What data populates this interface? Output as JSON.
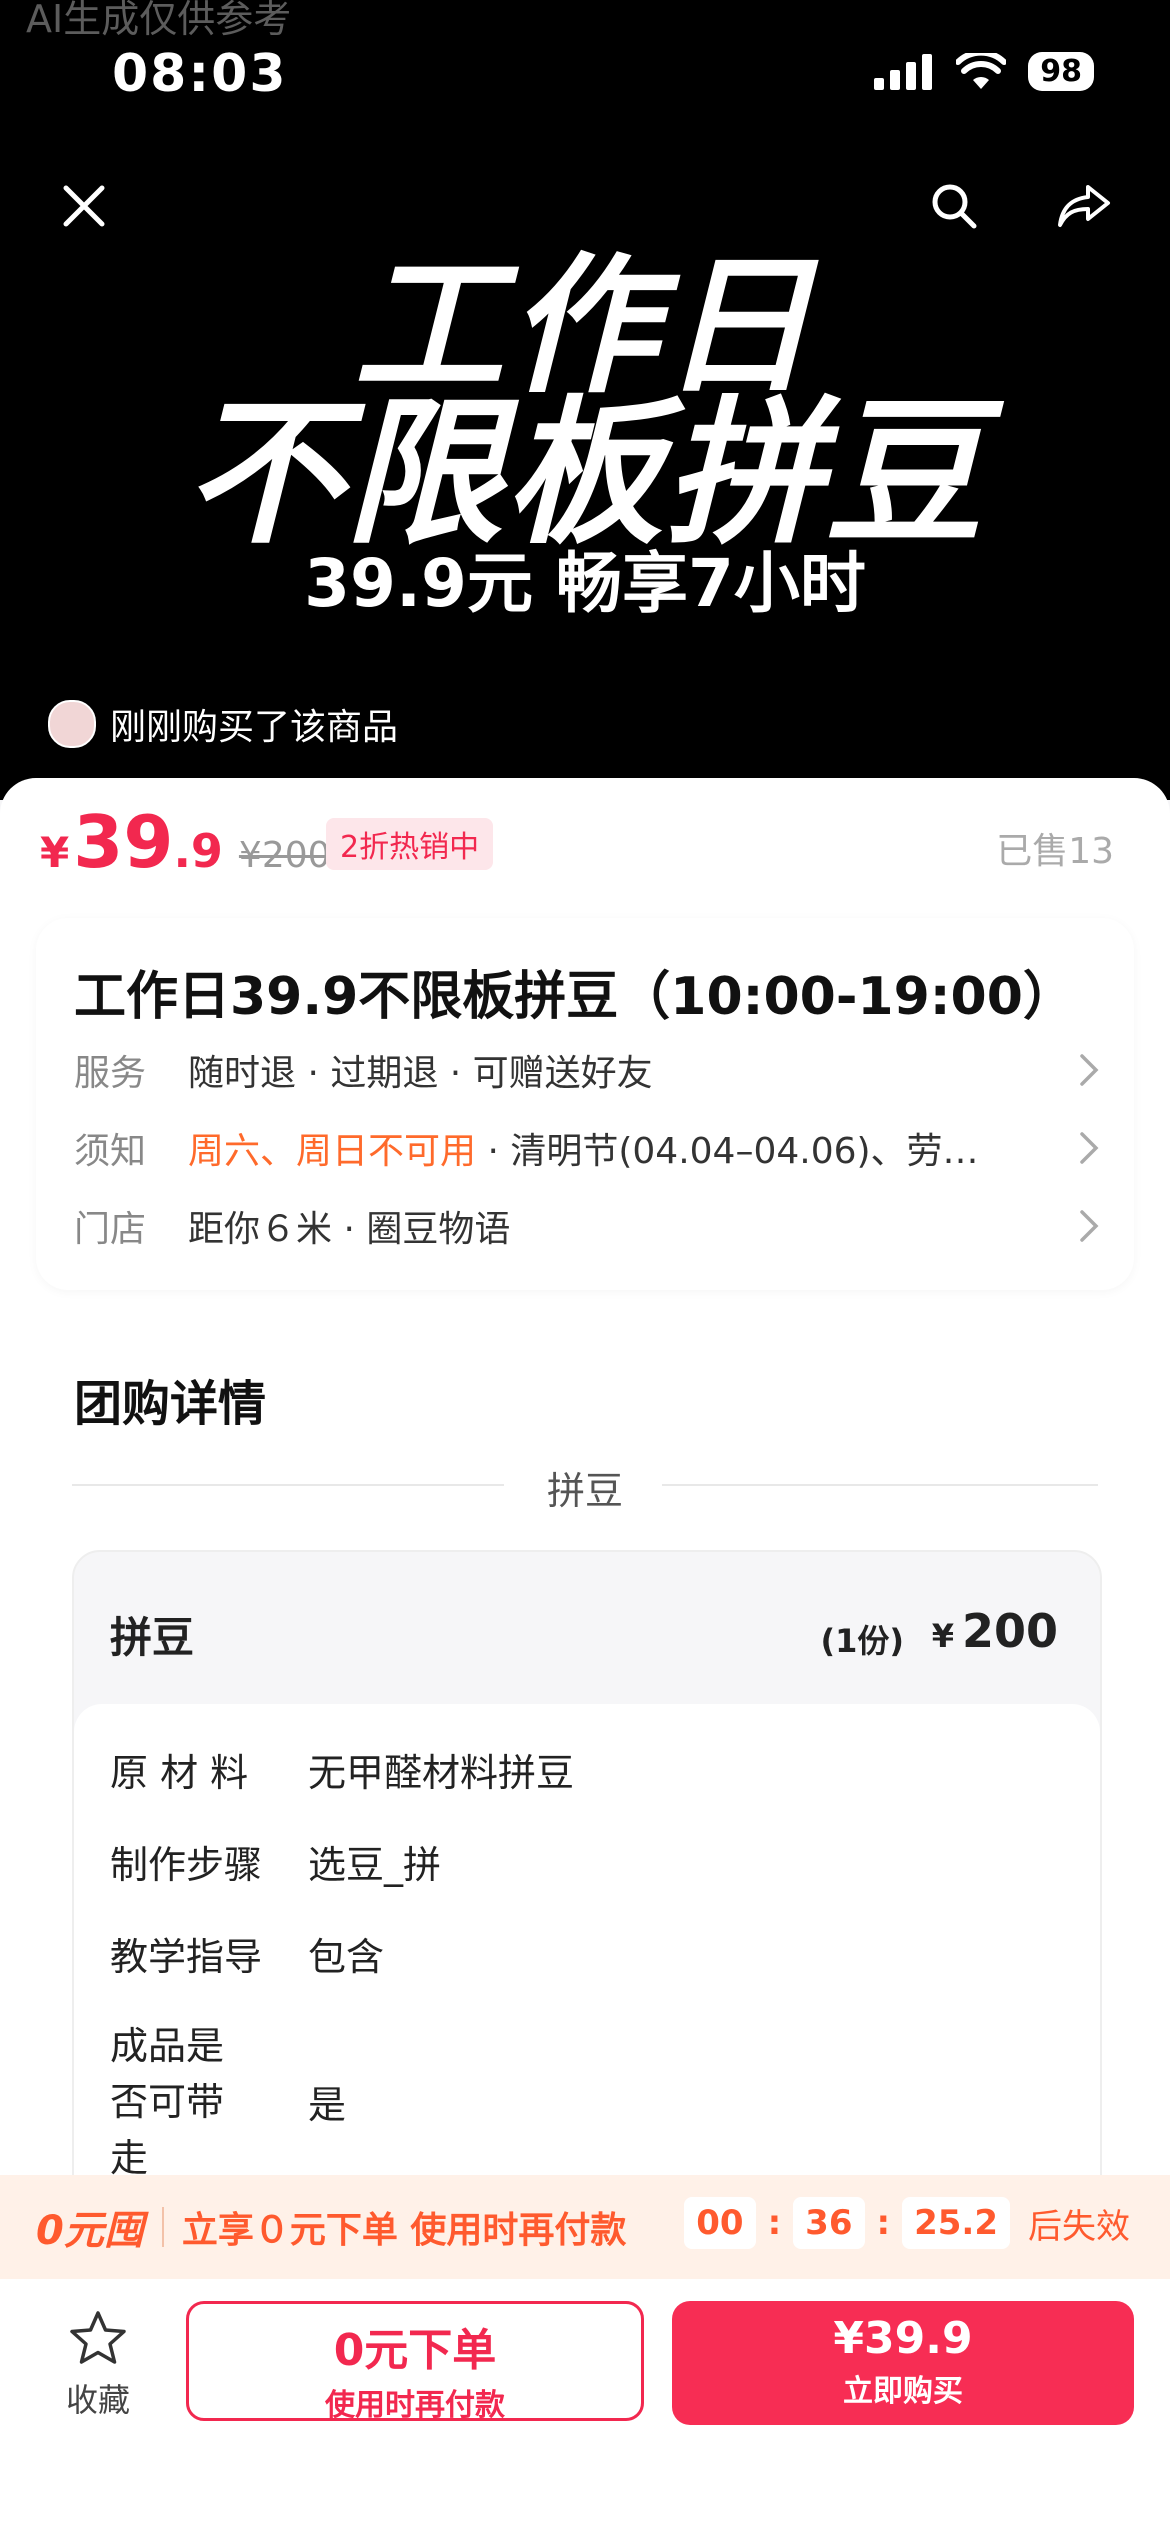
{
  "watermark": "AI生成仅供参考",
  "status_bar": {
    "time": "08:03",
    "battery": "98"
  },
  "hero": {
    "title_line1": "工作日",
    "title_line2": "不限板拼豆",
    "subtitle": "39.9元  畅享7小时",
    "recent_buyer": "刚刚购买了该商品"
  },
  "price": {
    "currency": "¥",
    "integer": "39",
    "decimal": ".9",
    "original": "¥200",
    "discount_badge": "2折热销中",
    "sold": "已售13"
  },
  "product": {
    "title": "工作日39.9不限板拼豆（10:00-19:00）",
    "rows": [
      {
        "label": "服务",
        "value": "随时退 · 过期退 · 可赠送好友"
      },
      {
        "label": "须知",
        "warn": "周六、周日不可用",
        "value": " · 清明节(04.04–04.06)、劳…"
      },
      {
        "label": "门店",
        "value": "距你６米 · 圈豆物语"
      }
    ]
  },
  "detail": {
    "title": "团购详情",
    "section": "拼豆",
    "package": {
      "name": "拼豆",
      "qty": "(1份)",
      "price_symbol": "¥",
      "price": "200",
      "items": [
        {
          "key": "原 材 料",
          "value": "无甲醛材料拼豆"
        },
        {
          "key": "制作步骤",
          "value": "选豆_拼"
        },
        {
          "key": "教学指导",
          "value": "包含"
        },
        {
          "key": "成品是\n否可带\n走",
          "value": "是"
        }
      ]
    }
  },
  "promo": {
    "logo": "0元囤",
    "text": "立享０元下单 使用时再付款",
    "timer": {
      "h": "00",
      "m": "36",
      "s": "25.2"
    },
    "expire": "后失效"
  },
  "bottom_bar": {
    "favorite": "收藏",
    "zero_order": {
      "main": "0元下单",
      "sub": "使用时再付款"
    },
    "buy_now": {
      "main": "¥39.9",
      "sub": "立即购买"
    }
  },
  "colors": {
    "accent": "#f2284f",
    "promo": "#ff5a2e",
    "warn": "#ff6a2b"
  }
}
